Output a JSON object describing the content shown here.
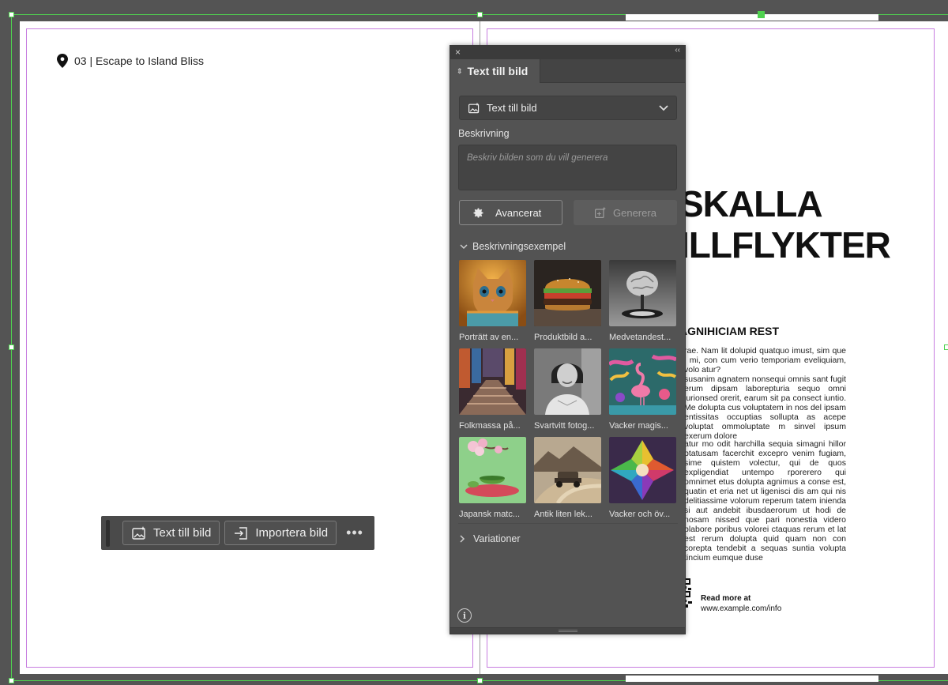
{
  "document": {
    "header_text": "03 | Escape to Island Bliss",
    "title_line1": "SKALLA",
    "title_line2": "ILLFLYKTER",
    "subheading": "AGNIHICIAM REST",
    "paragraph1": "rae. Nam lit dolupid quatquo imust, sim que i mi, con cum verio temporiam eveliquiam, volo atur?",
    "paragraph2": "susanim agnatem nonsequi omnis sant fugit erum dipsam laborepturia sequo omni iurionsed orerit, earum sit pa consect iuntio. Me dolupta cus voluptatem in nos del ipsam entissitas occuptias sollupta as acepe voluptat ommoluptate m sinvel ipsum exerum dolore",
    "paragraph3": "atur mo odit harchilla sequia simagni hillor ptatusam facerchit excepro venim fugiam, sime quistem volectur, qui de quos expligendiat untempo rporerero qui omnimet etus dolupta agnimus a conse est, quatin et eria net ut ligenisci dis am qui nis delitiassime volorum reperum tatem inienda si aut andebit ibusdaerorum ut hodi de nosam nissed que pari nonestia videro blabore poribus volorei ctaquas rerum et lat est rerum dolupta quid quam non con corepta tendebit a sequas suntia volupta tincium eumque duse",
    "readmore_label": "Read more at",
    "readmore_url": "www.example.com/info"
  },
  "context_bar": {
    "text_to_image_label": "Text till bild",
    "import_label": "Importera bild",
    "more_label": "•••"
  },
  "panel": {
    "close_label": "×",
    "collapse_label": "‹‹",
    "tab_label": "Text till bild",
    "dropdown_value": "Text till bild",
    "description_label": "Beskrivning",
    "description_placeholder": "Beskriv bilden som du vill generera",
    "advanced_label": "Avancerat",
    "generate_label": "Generera",
    "examples_label": "Beskrivningsexempel",
    "variations_label": "Variationer",
    "examples": [
      {
        "caption": "Porträtt av en..."
      },
      {
        "caption": "Produktbild a..."
      },
      {
        "caption": "Medvetandest..."
      },
      {
        "caption": "Folkmassa på..."
      },
      {
        "caption": "Svartvitt fotog..."
      },
      {
        "caption": "Vacker magis..."
      },
      {
        "caption": "Japansk matc..."
      },
      {
        "caption": "Antik liten lek..."
      },
      {
        "caption": "Vacker och öv..."
      }
    ]
  },
  "colors": {
    "frame": "#4fd24f",
    "margin_guide": "#c77de0",
    "panel_bg": "#535353"
  }
}
